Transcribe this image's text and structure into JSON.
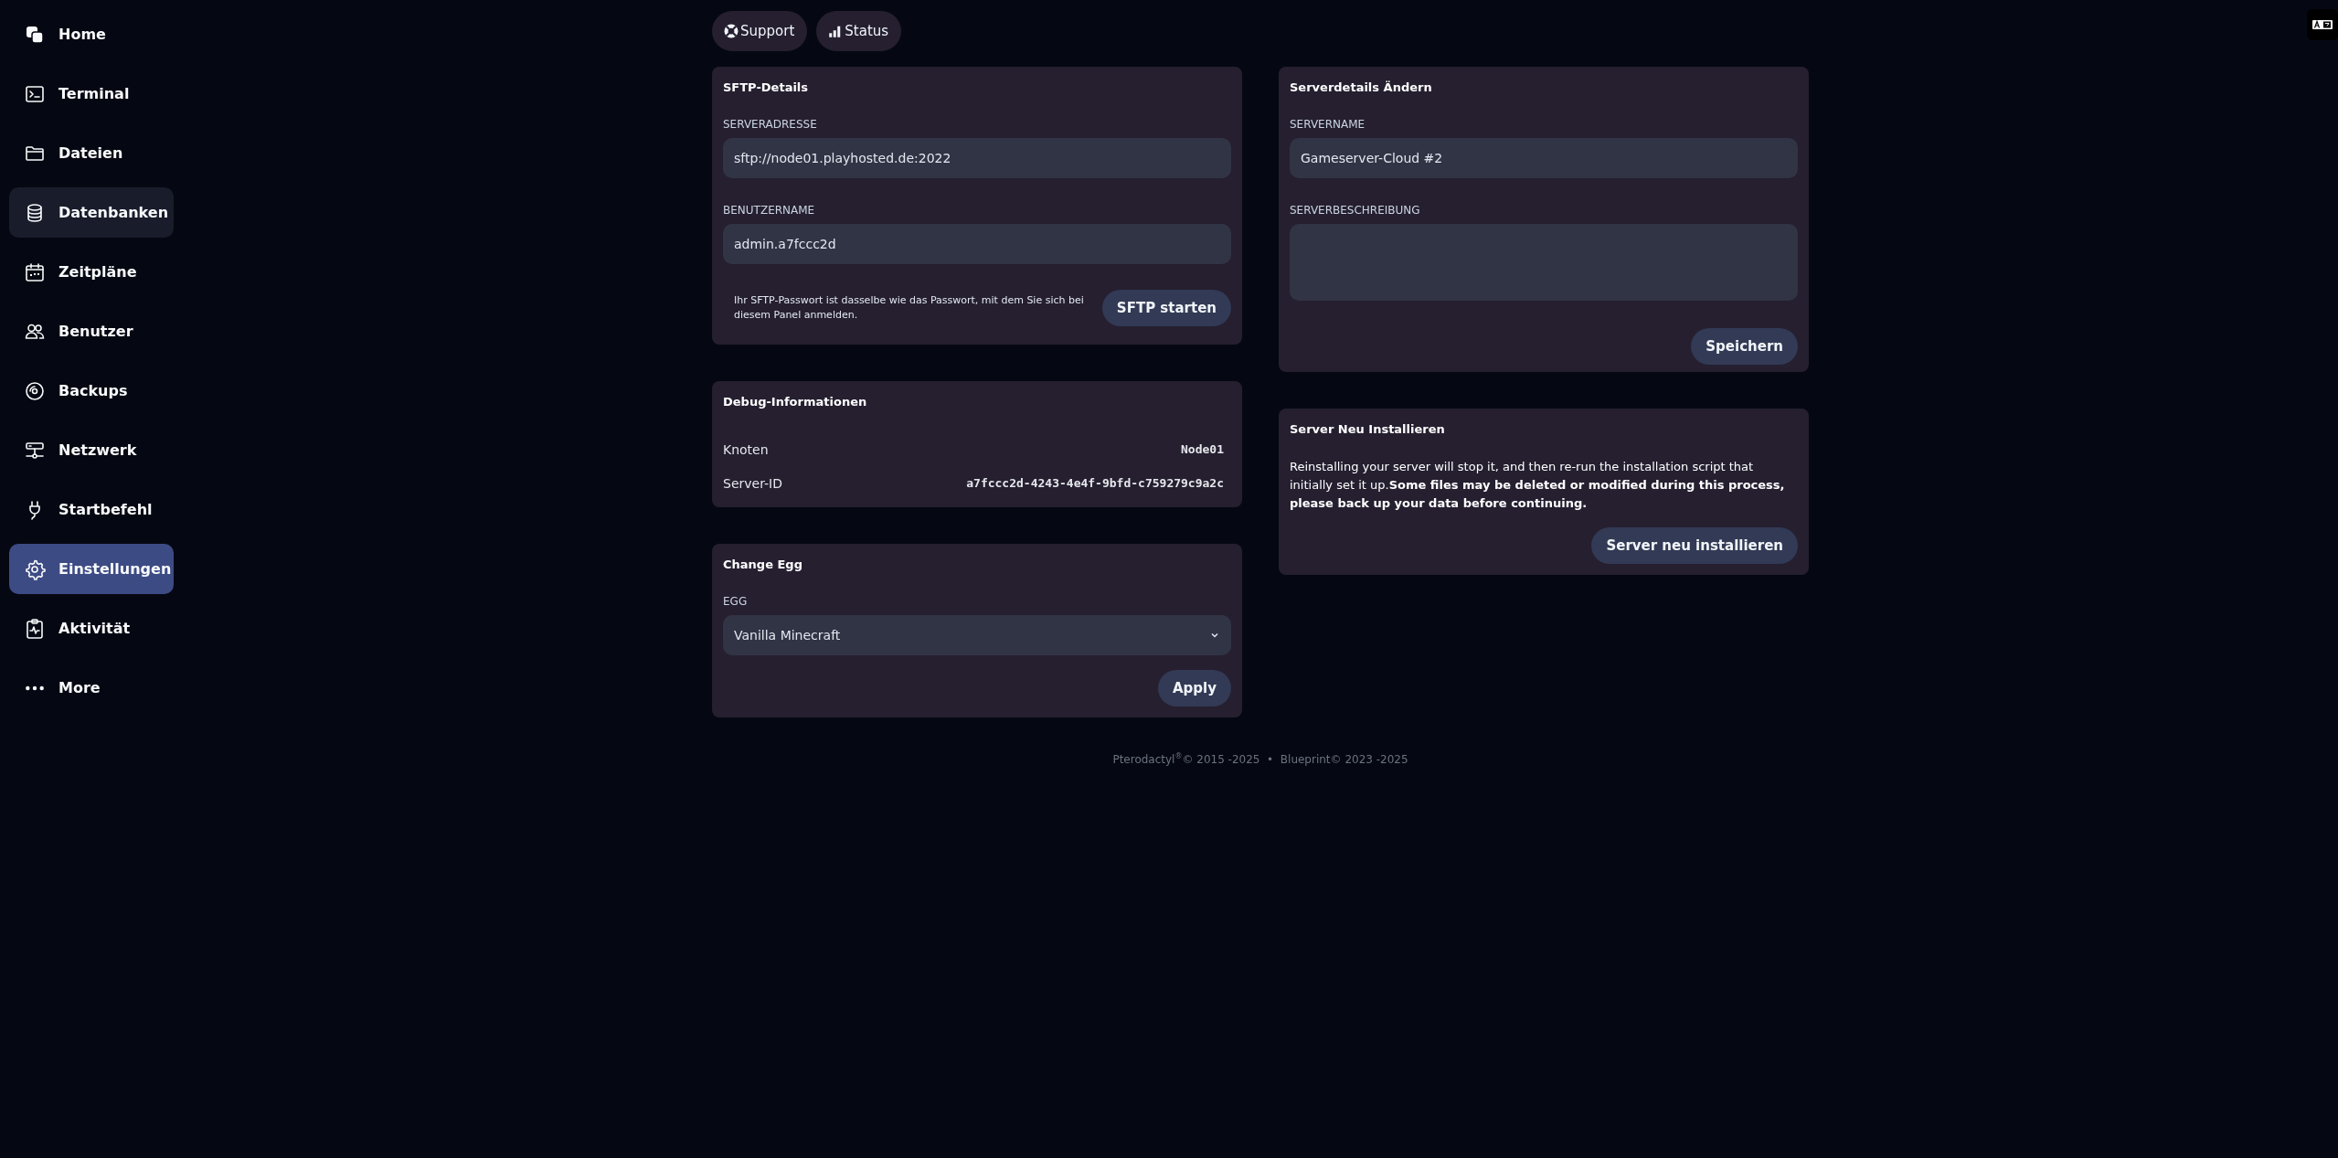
{
  "sidebar": {
    "items": [
      {
        "label": "Home",
        "kind": "home",
        "selected": false,
        "hovered": false
      },
      {
        "label": "Terminal",
        "kind": "terminal",
        "selected": false,
        "hovered": false
      },
      {
        "label": "Dateien",
        "kind": "folder",
        "selected": false,
        "hovered": false
      },
      {
        "label": "Datenbanken",
        "kind": "database",
        "selected": false,
        "hovered": true
      },
      {
        "label": "Zeitpläne",
        "kind": "calendar",
        "selected": false,
        "hovered": false
      },
      {
        "label": "Benutzer",
        "kind": "users",
        "selected": false,
        "hovered": false
      },
      {
        "label": "Backups",
        "kind": "disc",
        "selected": false,
        "hovered": false
      },
      {
        "label": "Netzwerk",
        "kind": "network",
        "selected": false,
        "hovered": false
      },
      {
        "label": "Startbefehl",
        "kind": "plug",
        "selected": false,
        "hovered": false
      },
      {
        "label": "Einstellungen",
        "kind": "gear",
        "selected": true,
        "hovered": false
      },
      {
        "label": "Aktivität",
        "kind": "activity",
        "selected": false,
        "hovered": false
      },
      {
        "label": "More",
        "kind": "dots",
        "selected": false,
        "hovered": false
      }
    ]
  },
  "top_links": [
    {
      "label": "Support",
      "kind": "support"
    },
    {
      "label": "Status",
      "kind": "status"
    }
  ],
  "sftp_details": {
    "title": "SFTP-Details",
    "fields": [
      {
        "label": "SERVERADRESSE",
        "value": "sftp://node01.playhosted.de:2022"
      },
      {
        "label": "BENUTZERNAME",
        "value": "admin.a7fccc2d"
      }
    ],
    "note": "Ihr SFTP-Passwort ist dasselbe wie das Passwort, mit dem Sie sich bei diesem Panel anmelden.",
    "button": "SFTP starten"
  },
  "debug_info": {
    "title": "Debug-Informationen",
    "rows": [
      {
        "label": "Knoten",
        "value": "Node01"
      },
      {
        "label": "Server-ID",
        "value": "a7fccc2d-4243-4e4f-9bfd-c759279c9a2c"
      }
    ]
  },
  "change_egg": {
    "title": "Change Egg",
    "label": "EGG",
    "value": "Vanilla Minecraft",
    "button": "Apply"
  },
  "server_details": {
    "title": "Serverdetails Ändern",
    "name_label": "SERVERNAME",
    "name_value": "Gameserver-Cloud #2",
    "description_label": "SERVERBESCHREIBUNG",
    "button": "Speichern"
  },
  "reinstall": {
    "title": "Server Neu Installieren",
    "text": "Reinstalling your server will stop it, and then re-run the installation script that initially set it up.**Some files may be deleted or modified during this process, please back up your data before continuing.**",
    "button": "Server neu installieren"
  },
  "footer": {
    "text": "Pterodactyl$^{®}$© 2015 -2025  •  Blueprint© 2023 -2025"
  }
}
